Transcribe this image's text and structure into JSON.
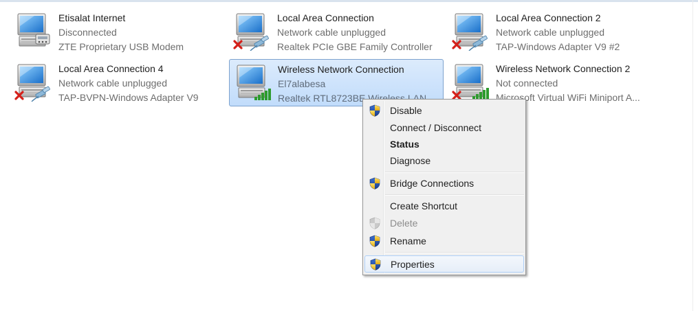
{
  "adapters": [
    {
      "name": "Etisalat Internet",
      "status": "Disconnected",
      "device": "ZTE Proprietary USB Modem",
      "icon": "modem-icon"
    },
    {
      "name": "Local Area Connection",
      "status": "Network cable unplugged",
      "device": "Realtek PCIe GBE Family Controller",
      "icon": "network-cable-unplugged-icon"
    },
    {
      "name": "Local Area Connection 2",
      "status": "Network cable unplugged",
      "device": "TAP-Windows Adapter V9 #2",
      "icon": "network-cable-unplugged-icon"
    },
    {
      "name": "Local Area Connection 4",
      "status": "Network cable unplugged",
      "device": "TAP-BVPN-Windows Adapter V9",
      "icon": "network-cable-unplugged-icon"
    },
    {
      "name": "Wireless Network Connection",
      "status": "El7alabesa",
      "device": "Realtek RTL8723BE Wireless LAN",
      "icon": "wireless-signal-icon"
    },
    {
      "name": "Wireless Network Connection 2",
      "status": "Not connected",
      "device": "Microsoft Virtual WiFi Miniport A...",
      "icon": "wireless-not-connected-icon"
    }
  ],
  "context_menu": {
    "items": [
      {
        "label": "Disable",
        "shield": true
      },
      {
        "label": "Connect / Disconnect",
        "shield": false
      },
      {
        "label": "Status",
        "shield": false,
        "bold": true
      },
      {
        "label": "Diagnose",
        "shield": false
      },
      {
        "label": "Bridge Connections",
        "shield": true
      },
      {
        "label": "Create Shortcut",
        "shield": false
      },
      {
        "label": "Delete",
        "shield": true,
        "disabled": true
      },
      {
        "label": "Rename",
        "shield": true
      },
      {
        "label": "Properties",
        "shield": true,
        "highlighted": true
      }
    ]
  },
  "colors": {
    "selection_fill": "#c8e0fb",
    "selection_border": "#7da2ce",
    "menu_background": "#f0f0f0",
    "menu_border": "#979797",
    "error_red": "#d4201a",
    "signal_green": "#2e9b2e"
  }
}
